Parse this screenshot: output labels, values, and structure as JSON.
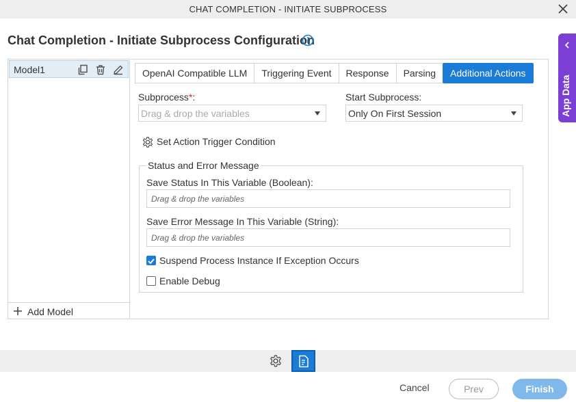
{
  "window": {
    "title": "CHAT COMPLETION - INITIATE SUBPROCESS"
  },
  "page": {
    "title": "Chat Completion - Initiate Subprocess Configuration"
  },
  "app_data": {
    "label": "App Data"
  },
  "models": {
    "items": [
      {
        "name": "Model1"
      }
    ],
    "add_label": "Add Model"
  },
  "tabs": [
    {
      "label": "OpenAI Compatible LLM",
      "active": false
    },
    {
      "label": "Triggering Event",
      "active": false
    },
    {
      "label": "Response",
      "active": false
    },
    {
      "label": "Parsing",
      "active": false
    },
    {
      "label": "Additional Actions",
      "active": true
    }
  ],
  "form": {
    "subprocess": {
      "label": "Subprocess",
      "required_mark": "*",
      "suffix": ":",
      "placeholder": "Drag & drop the variables"
    },
    "start_subprocess": {
      "label": "Start Subprocess:",
      "value": "Only On First Session"
    },
    "trigger_condition": {
      "label": "Set Action Trigger Condition"
    },
    "status_group": {
      "legend": "Status and Error Message",
      "save_status_label": "Save Status In This Variable (Boolean):",
      "save_status_placeholder": "Drag & drop the variables",
      "save_error_label": "Save Error Message In This Variable (String):",
      "save_error_placeholder": "Drag & drop the variables",
      "suspend_label": "Suspend Process Instance If Exception Occurs",
      "suspend_checked": true,
      "debug_label": "Enable Debug",
      "debug_checked": false
    }
  },
  "footer": {
    "cancel": "Cancel",
    "prev": "Prev",
    "finish": "Finish"
  },
  "colors": {
    "accent": "#1a7cd6",
    "app_data": "#7c3fd6",
    "required": "#d9262c",
    "finish_disabled": "#7fb8ea"
  }
}
